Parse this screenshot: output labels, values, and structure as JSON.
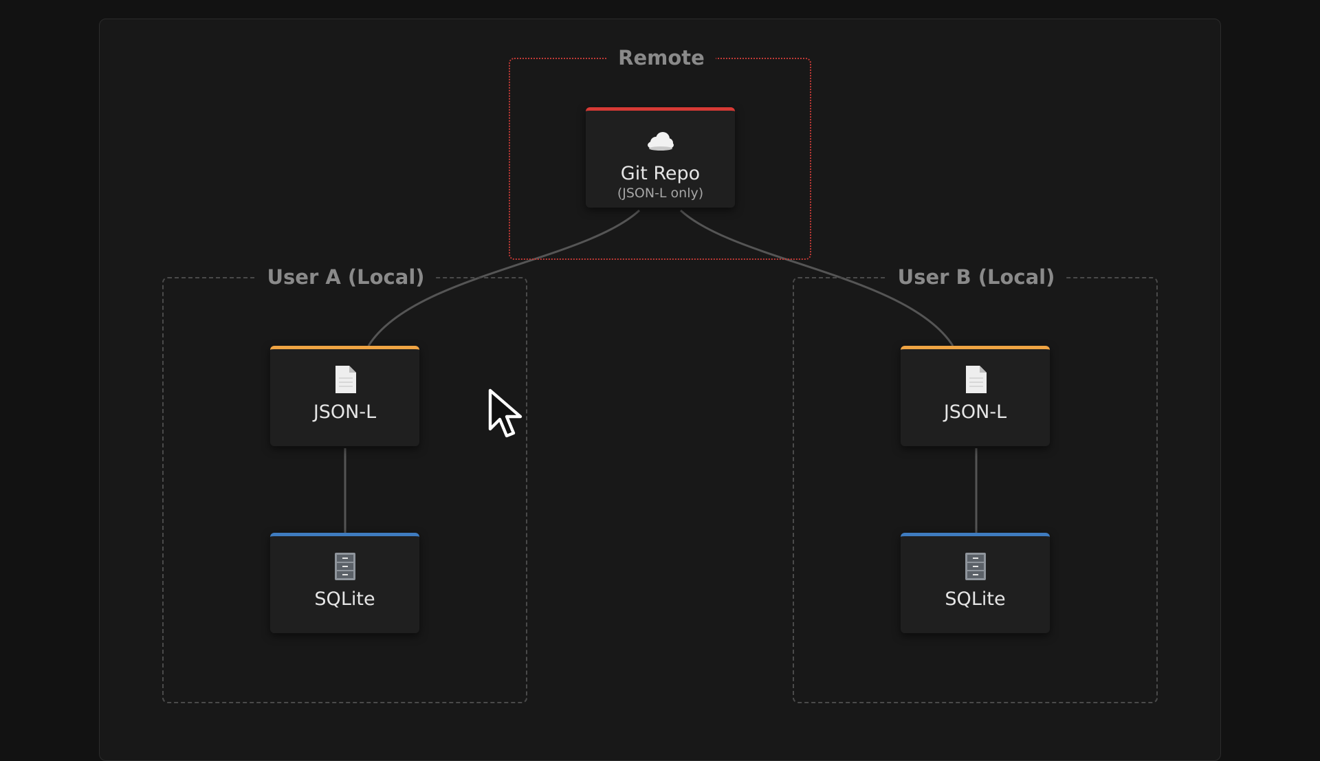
{
  "groups": {
    "remote": {
      "label": "Remote"
    },
    "user_a": {
      "label": "User A (Local)"
    },
    "user_b": {
      "label": "User B (Local)"
    }
  },
  "nodes": {
    "git_repo": {
      "title": "Git Repo",
      "subtitle": "(JSON-L only)",
      "icon": "cloud-icon",
      "accent": "#d63a35"
    },
    "user_a_jsonl": {
      "title": "JSON-L",
      "icon": "document-icon",
      "accent": "#efa443"
    },
    "user_a_sqlite": {
      "title": "SQLite",
      "icon": "file-cabinet-icon",
      "accent": "#3f7cc0"
    },
    "user_b_jsonl": {
      "title": "JSON-L",
      "icon": "document-icon",
      "accent": "#efa443"
    },
    "user_b_sqlite": {
      "title": "SQLite",
      "icon": "file-cabinet-icon",
      "accent": "#3f7cc0"
    }
  },
  "edges": [
    {
      "from": "git_repo",
      "to": "user_a_jsonl"
    },
    {
      "from": "git_repo",
      "to": "user_b_jsonl"
    },
    {
      "from": "user_a_jsonl",
      "to": "user_a_sqlite"
    },
    {
      "from": "user_b_jsonl",
      "to": "user_b_sqlite"
    }
  ]
}
